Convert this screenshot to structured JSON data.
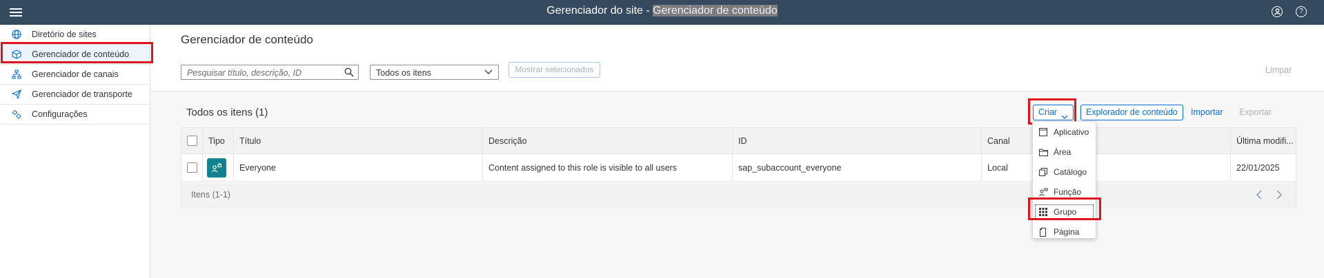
{
  "shell": {
    "title_prefix": "Gerenciador do site - ",
    "title_highlight": "Gerenciador de conteúdo"
  },
  "sidebar": {
    "items": [
      {
        "label": "Diretório de sites",
        "icon": "globe-icon"
      },
      {
        "label": "Gerenciador de conteúdo",
        "icon": "cube-icon"
      },
      {
        "label": "Gerenciador de canais",
        "icon": "hierarchy-icon"
      },
      {
        "label": "Gerenciador de transporte",
        "icon": "paper-plane-icon"
      },
      {
        "label": "Configurações",
        "icon": "settings-icon"
      }
    ],
    "selected_index": 1
  },
  "main": {
    "title": "Gerenciador de conteúdo",
    "search_placeholder": "Pesquisar título, descrição, ID",
    "filter_value": "Todos os itens",
    "show_selected_label": "Mostrar selecionados",
    "clear_label": "Limpar"
  },
  "table_toolbar": {
    "title": "Todos os itens (1)",
    "create_label": "Criar",
    "explorer_label": "Explorador de conteúdo",
    "import_label": "Importar",
    "export_label": "Exportar"
  },
  "table": {
    "columns": [
      "Tipo",
      "Título",
      "Descrição",
      "ID",
      "Canal",
      "Última modifi..."
    ],
    "rows": [
      {
        "titulo": "Everyone",
        "descricao": "Content assigned to this role is visible to all users",
        "id": "sap_subaccount_everyone",
        "canal": "Local",
        "modificado": "22/01/2025"
      }
    ],
    "footer": "Itens (1-1)"
  },
  "create_menu": {
    "items": [
      {
        "label": "Aplicativo",
        "icon": "app-window-icon"
      },
      {
        "label": "Área",
        "icon": "folder-icon"
      },
      {
        "label": "Catálogo",
        "icon": "catalog-icon"
      },
      {
        "label": "Função",
        "icon": "role-icon"
      },
      {
        "label": "Grupo",
        "icon": "grid-icon"
      },
      {
        "label": "Página",
        "icon": "page-icon"
      }
    ]
  },
  "colors": {
    "shell": "#354a5f",
    "accent": "#0a6ed1",
    "highlight_box": "#e0141e",
    "type_tile": "#0f828f"
  }
}
